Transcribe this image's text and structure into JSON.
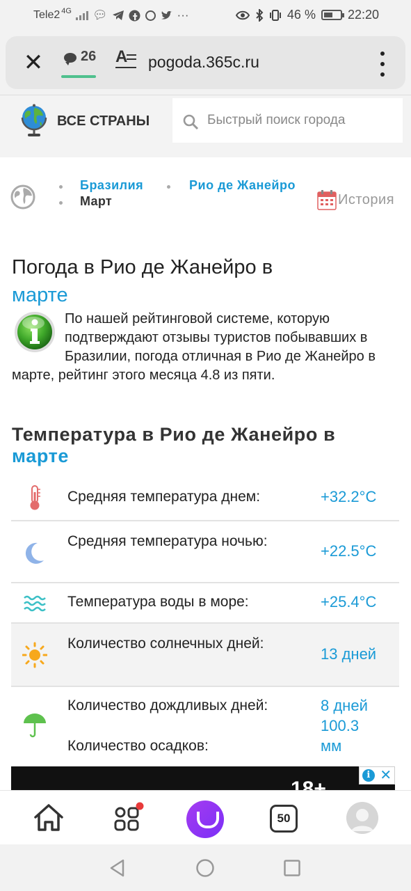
{
  "status_bar": {
    "carrier": "Tele2",
    "network": "4G",
    "battery": "46 %",
    "time": "22:20",
    "more": "···"
  },
  "browser": {
    "close_icon": "close-icon",
    "tab_count": "26",
    "url": "pogoda.365c.ru",
    "reader_icon": "reader-mode-icon",
    "menu_icon": "more-vertical-icon"
  },
  "site_header": {
    "all_countries": "ВСЕ СТРАНЫ",
    "search_placeholder": "Быстрый поиск города"
  },
  "breadcrumb": {
    "country": "Бразилия",
    "city": "Рио де Жанейро",
    "current": "Март",
    "history": "История"
  },
  "title": {
    "main": "Погода в Рио де Жанейро в",
    "accent": "марте"
  },
  "intro": "По нашей рейтинговой системе, которую подтверждают отзывы туристов побывавших в Бразилии, погода отличная в Рио де Жанейро в марте, рейтинг этого месяца 4.8 из пяти.",
  "section": {
    "title": "Температура в Рио де Жанейро в",
    "accent": "марте"
  },
  "stats": [
    {
      "icon": "thermometer-icon",
      "label": "Средняя температура днем:",
      "value": "+32.2°C"
    },
    {
      "icon": "moon-icon",
      "label": "Средняя температура ночью:",
      "value": "+22.5°C"
    },
    {
      "icon": "water-waves-icon",
      "label": "Температура воды в море:",
      "value": "+25.4°C"
    },
    {
      "icon": "sun-icon",
      "label": "Количество солнечных дней:",
      "value": "13 дней"
    },
    {
      "icon": "umbrella-icon",
      "label_1": "Количество дождливых дней:",
      "value_1": "8 дней",
      "label_2": "Количество осадков:",
      "value_2": "100.3 мм"
    }
  ],
  "ad": {
    "age": "18+",
    "info": "i",
    "close": "✕"
  },
  "bottom_nav": {
    "tabs_count": "50"
  },
  "colors": {
    "accent": "#1a9ad6",
    "shaded_row": "#f3f3f3",
    "alice": "#8b35f4"
  }
}
